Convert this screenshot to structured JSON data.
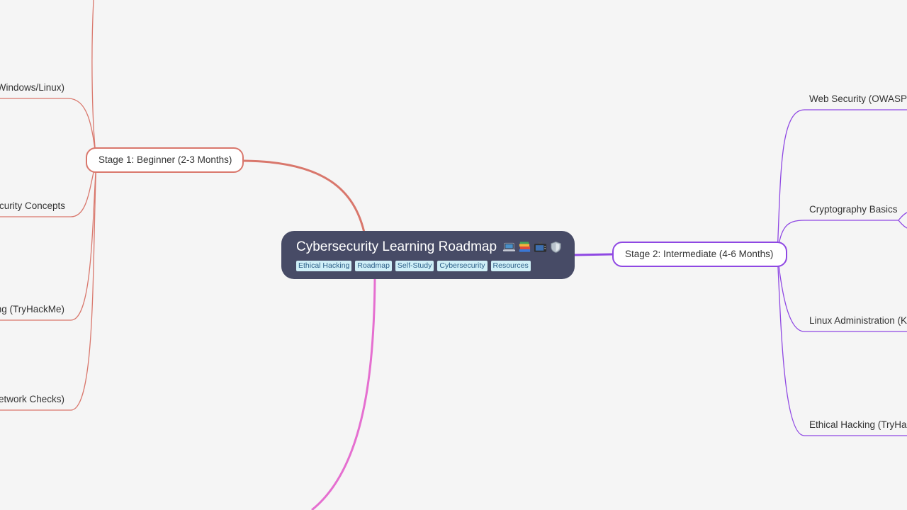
{
  "central": {
    "title": "Cybersecurity Learning Roadmap",
    "emojis": [
      "laptop-icon",
      "books-icon",
      "tv-icon",
      "shield-icon"
    ],
    "labels": [
      "Ethical Hacking",
      "Roadmap",
      "Self-Study",
      "Cybersecurity",
      "Resources"
    ]
  },
  "stage1": {
    "title": "Stage 1: Beginner (2-3 Months)",
    "color": "#d9776c",
    "subtopics": [
      "Windows/Linux)",
      "curity Concepts",
      "ng (TryHackMe)",
      "etwork Checks)"
    ]
  },
  "stage2": {
    "title": "Stage 2: Intermediate (4-6 Months)",
    "color": "#8f48e3",
    "subtopics": [
      "Web Security (OWASP G",
      "Cryptography Basics",
      "Linux Administration (K",
      "Ethical Hacking (TryHac"
    ]
  },
  "stage3_branch_color": "#e56fd0",
  "colors": {
    "background": "#f5f5f5",
    "central_fill": "#474b66",
    "label_chip": "#cfeff7",
    "label_text": "#2c5f88"
  }
}
